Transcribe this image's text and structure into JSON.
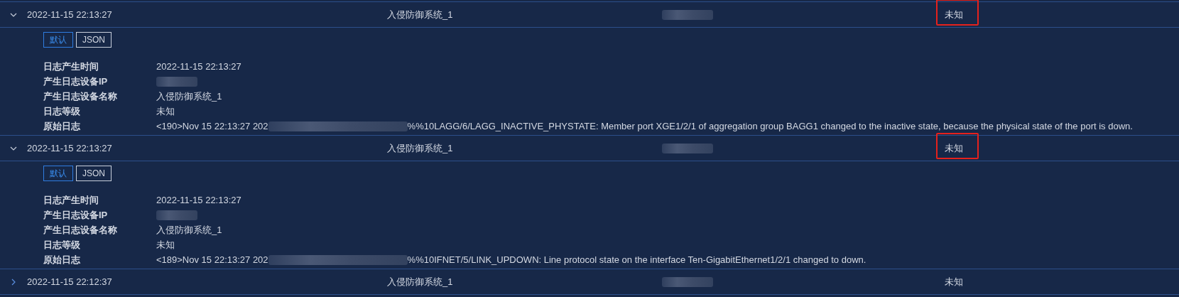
{
  "rows": [
    {
      "expanded": true,
      "time": "2022-11-15 22:13:27",
      "device_name": "入侵防御系统_1",
      "ip_redacted": true,
      "level": "未知",
      "highlighted": true,
      "view_tabs": [
        {
          "label": "默认",
          "selected": true
        },
        {
          "label": "JSON",
          "selected": false
        }
      ],
      "details": [
        {
          "label": "日志产生时间",
          "value": "2022-11-15 22:13:27",
          "kind": "text"
        },
        {
          "label": "产生日志设备IP",
          "kind": "redacted"
        },
        {
          "label": "产生日志设备名称",
          "value": "入侵防御系统_1",
          "kind": "text"
        },
        {
          "label": "日志等级",
          "value": "未知",
          "kind": "text"
        },
        {
          "label": "原始日志",
          "value_before": "<190>Nov 15 22:13:27 202",
          "value_after": "%%10LAGG/6/LAGG_INACTIVE_PHYSTATE: Member port XGE1/2/1 of aggregation group BAGG1 changed to the inactive state, because the physical state of the port is down.",
          "kind": "partly_redacted"
        }
      ]
    },
    {
      "expanded": true,
      "time": "2022-11-15 22:13:27",
      "device_name": "入侵防御系统_1",
      "ip_redacted": true,
      "level": "未知",
      "highlighted": true,
      "view_tabs": [
        {
          "label": "默认",
          "selected": true
        },
        {
          "label": "JSON",
          "selected": false
        }
      ],
      "details": [
        {
          "label": "日志产生时间",
          "value": "2022-11-15 22:13:27",
          "kind": "text"
        },
        {
          "label": "产生日志设备IP",
          "kind": "redacted"
        },
        {
          "label": "产生日志设备名称",
          "value": "入侵防御系统_1",
          "kind": "text"
        },
        {
          "label": "日志等级",
          "value": "未知",
          "kind": "text"
        },
        {
          "label": "原始日志",
          "value_before": "<189>Nov 15 22:13:27 202",
          "value_after": "%%10IFNET/5/LINK_UPDOWN: Line protocol state on the interface Ten-GigabitEthernet1/2/1 changed to down.",
          "kind": "partly_redacted"
        }
      ]
    },
    {
      "expanded": false,
      "time": "2022-11-15 22:12:37",
      "device_name": "入侵防御系统_1",
      "ip_redacted": true,
      "level": "未知",
      "highlighted": false
    }
  ]
}
